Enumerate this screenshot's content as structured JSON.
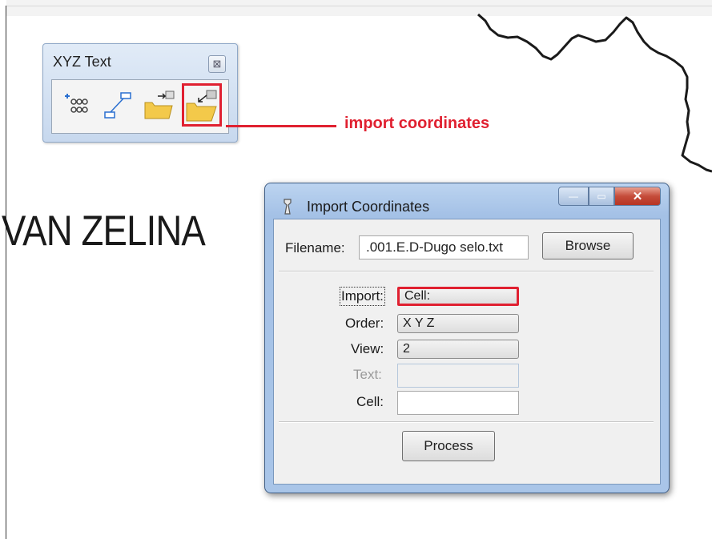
{
  "map": {
    "label": "VAN ZELINA"
  },
  "toolbox": {
    "title": "XYZ Text",
    "close_glyph": "⊠",
    "tools": [
      {
        "icon": "export-coordinates-icon"
      },
      {
        "icon": "connect-points-icon"
      },
      {
        "icon": "open-folder-export-icon"
      },
      {
        "icon": "import-coordinates-folder-icon",
        "selected": true
      }
    ]
  },
  "callout": {
    "text": "import coordinates",
    "color": "#e02030"
  },
  "dialog": {
    "title": "Import Coordinates",
    "min_glyph": "—",
    "max_glyph": "▭",
    "close_glyph": "✕",
    "filename_label": "Filename:",
    "filename_value": ".001.E.D-Dugo selo.txt",
    "browse_label": "Browse",
    "import_label": "Import:",
    "import_value": "Cell:",
    "order_label": "Order:",
    "order_value": "X Y Z",
    "view_label": "View:",
    "view_value": "2",
    "text_label": "Text:",
    "cell_label": "Cell:",
    "process_label": "Process"
  },
  "colors": {
    "highlight": "#e02030",
    "window_frame": "#a9c5e8"
  }
}
